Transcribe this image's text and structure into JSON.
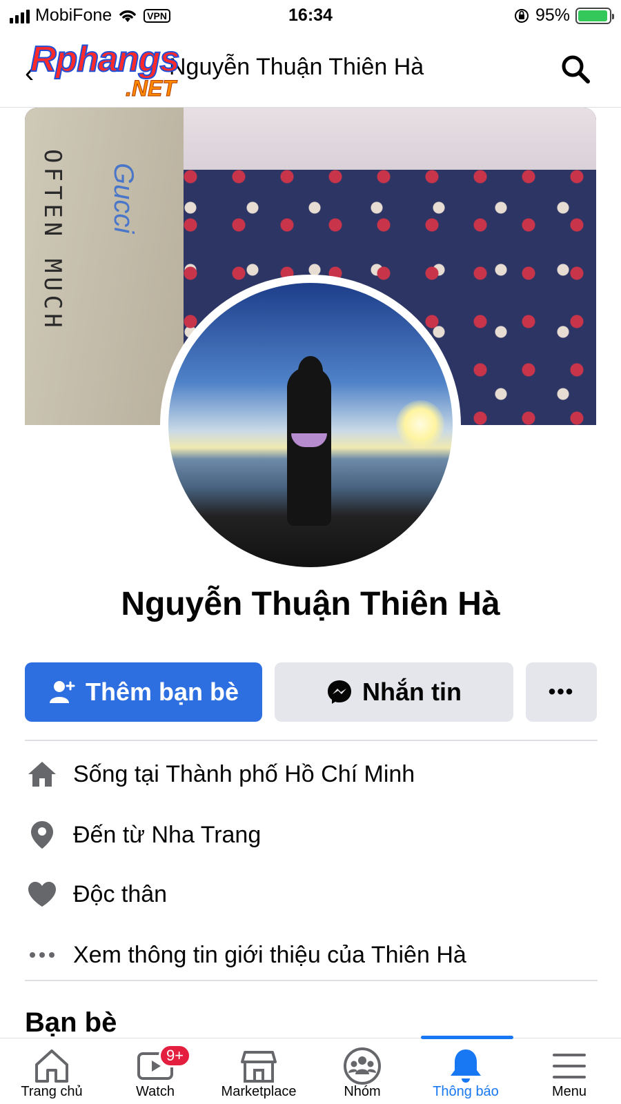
{
  "status_bar": {
    "carrier": "MobiFone",
    "vpn": "VPN",
    "time": "16:34",
    "battery": "95%",
    "battery_level": 0.95
  },
  "header": {
    "title": "Nguyễn Thuận Thiên Hà",
    "watermark_main": "Rphangs",
    "watermark_sub": ".NET"
  },
  "cover": {
    "pillow_text": "OFTEN MUCH",
    "pillow_blue": "Gucci"
  },
  "profile": {
    "name": "Nguyễn Thuận Thiên Hà"
  },
  "actions": {
    "add_friend": "Thêm bạn bè",
    "message": "Nhắn tin",
    "more": "•••"
  },
  "info": {
    "lives_prefix": "Sống tại ",
    "lives_value": "Thành phố Hồ Chí Minh",
    "from_prefix": "Đến từ ",
    "from_value": "Nha Trang",
    "relationship": "Độc thân",
    "see_about": "Xem thông tin giới thiệu của Thiên Hà"
  },
  "friends_section": {
    "title": "Bạn bè"
  },
  "tabbar": {
    "tabs": [
      {
        "label": "Trang chủ"
      },
      {
        "label": "Watch",
        "badge": "9+"
      },
      {
        "label": "Marketplace"
      },
      {
        "label": "Nhóm"
      },
      {
        "label": "Thông báo"
      },
      {
        "label": "Menu"
      }
    ],
    "active_color": "#1877f2"
  }
}
